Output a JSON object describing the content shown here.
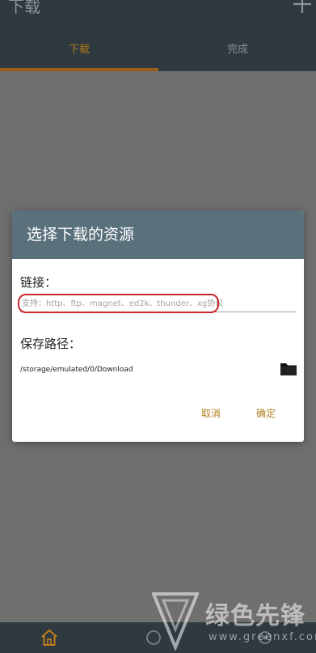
{
  "app": {
    "title": "下载"
  },
  "tabs": [
    {
      "label": "下载",
      "active": true
    },
    {
      "label": "完成",
      "active": false
    }
  ],
  "dialog": {
    "title": "选择下载的资源",
    "link_label": "链接：",
    "link_value": "",
    "link_placeholder": "支持：http、ftp、magnet、ed2k、thunder、xg协议",
    "path_label": "保存路径：",
    "path_value": "/storage/emulated/0/Download",
    "cancel_label": "取消",
    "ok_label": "确定"
  },
  "icons": {
    "add": "plus-icon",
    "folder": "folder-icon",
    "home": "home-icon"
  },
  "colors": {
    "appbar": "#2f3a40",
    "dialog_header": "#5a717c",
    "accent": "#b3801f",
    "annotation": "#c8282a"
  },
  "watermark": {
    "brand": "绿色先锋",
    "url": "www.greenxf.com"
  }
}
